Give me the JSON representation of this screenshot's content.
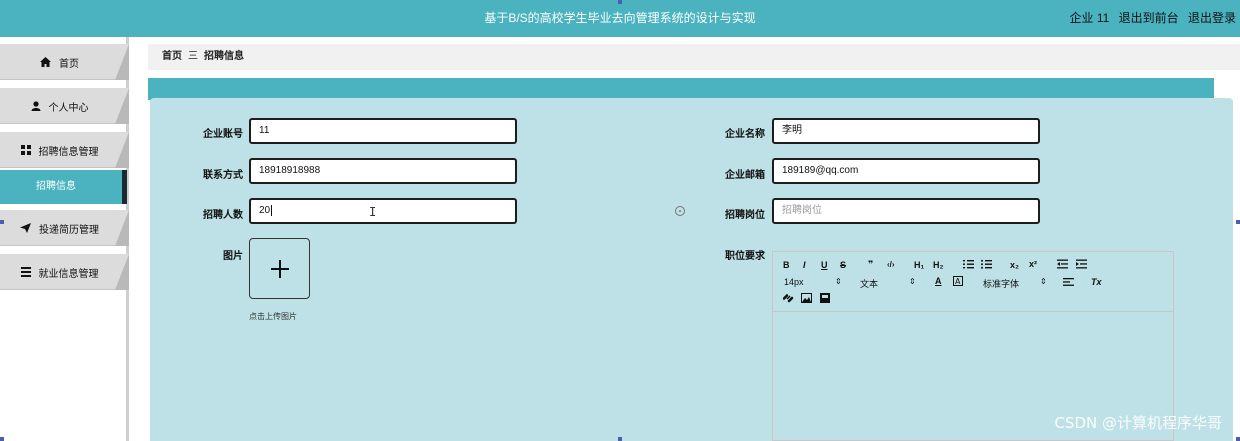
{
  "header": {
    "title": "基于B/S的高校学生毕业去向管理系统的设计与实现",
    "user": "企业 11",
    "back_to_front": "退出到前台",
    "logout": "退出登录"
  },
  "sidebar": {
    "items": [
      {
        "label": "首页",
        "icon": "home-icon"
      },
      {
        "label": "个人中心",
        "icon": "user-icon"
      },
      {
        "label": "招聘信息管理",
        "icon": "grid-icon"
      },
      {
        "label": "投递简历管理",
        "icon": "send-icon"
      },
      {
        "label": "就业信息管理",
        "icon": "list-icon"
      }
    ],
    "sub_item": {
      "label": "招聘信息"
    }
  },
  "breadcrumb": {
    "home": "首页",
    "separator": "三",
    "current": "招聘信息"
  },
  "form": {
    "account_label": "企业账号",
    "account_value": "11",
    "name_label": "企业名称",
    "name_value": "李明",
    "contact_label": "联系方式",
    "contact_value": "18918918988",
    "email_label": "企业邮箱",
    "email_value": "189189@qq.com",
    "count_label": "招聘人数",
    "count_value": "20",
    "position_label": "招聘岗位",
    "position_placeholder": "招聘岗位",
    "image_label": "图片",
    "upload_hint": "点击上传图片",
    "requirements_label": "职位要求"
  },
  "editor": {
    "bold": "B",
    "italic": "I",
    "underline": "U",
    "strike": "S",
    "quote": "❞",
    "code": "‹/›",
    "h1": "H₁",
    "h2": "H₂",
    "sub": "x₂",
    "sup": "x²",
    "size": "14px",
    "text_style": "文本",
    "font": "标准字体",
    "clear_format": "Tx"
  },
  "watermark": "CSDN @计算机程序华哥"
}
